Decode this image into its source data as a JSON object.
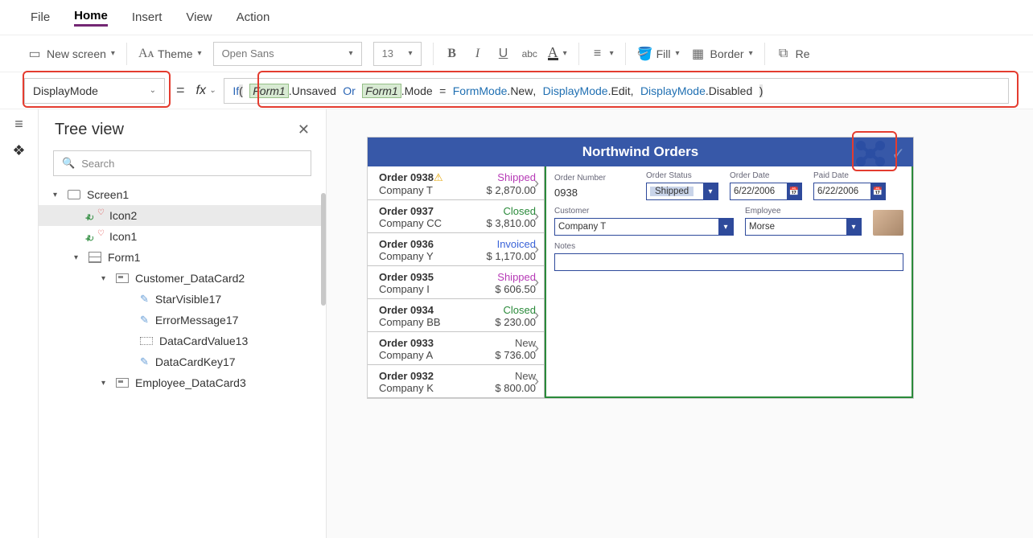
{
  "menu": {
    "file": "File",
    "home": "Home",
    "insert": "Insert",
    "view": "View",
    "action": "Action"
  },
  "toolbar": {
    "new_screen": "New screen",
    "theme": "Theme",
    "font": "Open Sans",
    "size": "13",
    "fill": "Fill",
    "border": "Border",
    "re": "Re"
  },
  "formula": {
    "prop": "DisplayMode",
    "t1": "If",
    "lp": "(",
    "sp": " ",
    "f1": "Form1",
    "dot": ".",
    "unsaved": "Unsaved",
    "or": "Or",
    "mode": "Mode",
    "eq": "=",
    "fmode": "FormMode",
    "new": "New",
    "comma": ",",
    "dm": "DisplayMode",
    "edit": "Edit",
    "disabled": "Disabled",
    "rp": ")"
  },
  "panel": {
    "title": "Tree view",
    "search_ph": "Search"
  },
  "tree": [
    {
      "lvl": 0,
      "caret": "▾",
      "icon": "screen",
      "label": "Screen1"
    },
    {
      "lvl": 1,
      "caret": "",
      "icon": "mini",
      "label": "Icon2",
      "sel": true
    },
    {
      "lvl": 1,
      "caret": "",
      "icon": "mini",
      "label": "Icon1"
    },
    {
      "lvl": 1,
      "caret": "▾",
      "icon": "form",
      "label": "Form1"
    },
    {
      "lvl": 2,
      "caret": "▾",
      "icon": "card",
      "label": "Customer_DataCard2"
    },
    {
      "lvl": 3,
      "caret": "",
      "icon": "pencil",
      "label": "StarVisible17"
    },
    {
      "lvl": 3,
      "caret": "",
      "icon": "pencil",
      "label": "ErrorMessage17"
    },
    {
      "lvl": 3,
      "caret": "",
      "icon": "value",
      "label": "DataCardValue13"
    },
    {
      "lvl": 3,
      "caret": "",
      "icon": "pencil",
      "label": "DataCardKey17"
    },
    {
      "lvl": 2,
      "caret": "▾",
      "icon": "card",
      "label": "Employee_DataCard3"
    }
  ],
  "app": {
    "title": "Northwind Orders",
    "orders": [
      {
        "num": "Order 0938",
        "warn": true,
        "status": "Shipped",
        "company": "Company T",
        "amount": "$ 2,870.00"
      },
      {
        "num": "Order 0937",
        "status": "Closed",
        "company": "Company CC",
        "amount": "$ 3,810.00"
      },
      {
        "num": "Order 0936",
        "status": "Invoiced",
        "company": "Company Y",
        "amount": "$ 1,170.00"
      },
      {
        "num": "Order 0935",
        "status": "Shipped",
        "company": "Company I",
        "amount": "$ 606.50"
      },
      {
        "num": "Order 0934",
        "status": "Closed",
        "company": "Company BB",
        "amount": "$ 230.00"
      },
      {
        "num": "Order 0933",
        "status": "New",
        "company": "Company A",
        "amount": "$ 736.00"
      },
      {
        "num": "Order 0932",
        "status": "New",
        "company": "Company K",
        "amount": "$ 800.00"
      }
    ],
    "detail": {
      "ordnum_lbl": "Order Number",
      "ordnum": "0938",
      "status_lbl": "Order Status",
      "status": "Shipped",
      "orddate_lbl": "Order Date",
      "orddate": "6/22/2006",
      "paiddate_lbl": "Paid Date",
      "paiddate": "6/22/2006",
      "cust_lbl": "Customer",
      "cust": "Company T",
      "emp_lbl": "Employee",
      "emp": "Morse",
      "notes_lbl": "Notes"
    }
  }
}
